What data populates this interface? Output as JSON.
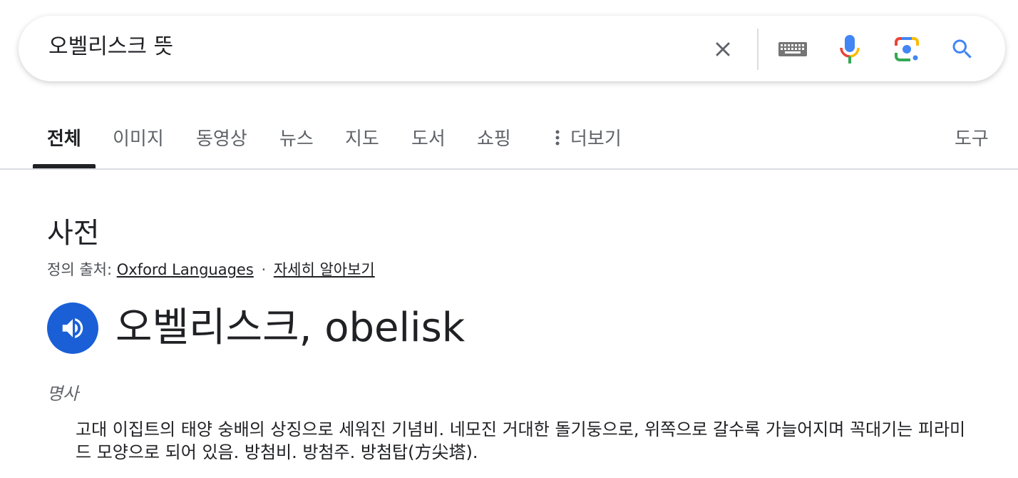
{
  "search": {
    "query": "오벨리스크 뜻"
  },
  "tabs": [
    {
      "label": "전체",
      "active": true
    },
    {
      "label": "이미지"
    },
    {
      "label": "동영상"
    },
    {
      "label": "뉴스"
    },
    {
      "label": "지도"
    },
    {
      "label": "도서"
    },
    {
      "label": "쇼핑"
    },
    {
      "label": "더보기"
    }
  ],
  "tools_label": "도구",
  "dictionary": {
    "title": "사전",
    "source_prefix": "정의 출처:",
    "source_link": "Oxford Languages",
    "separator": "·",
    "learn_more": "자세히 알아보기",
    "headword": "오벨리스크, obelisk",
    "part_of_speech": "명사",
    "definition": "고대 이집트의 태양 숭배의 상징으로 세워진 기념비. 네모진 거대한 돌기둥으로, 위쪽으로 갈수록 가늘어지며 꼭대기는 피라미드 모양으로 되어 있음. 방첨비. 방첨주. 방첨탑(方尖塔)."
  },
  "icons": {
    "clear": "close-icon",
    "keyboard": "keyboard-icon",
    "voice": "microphone-icon",
    "lens": "camera-lens-icon",
    "search": "search-icon",
    "more": "more-vert-icon",
    "speaker": "volume-icon"
  },
  "colors": {
    "google_blue": "#4285F4",
    "google_red": "#EA4335",
    "google_yellow": "#FBBC04",
    "google_green": "#34A853",
    "speaker_bg": "#1a5fd6"
  }
}
